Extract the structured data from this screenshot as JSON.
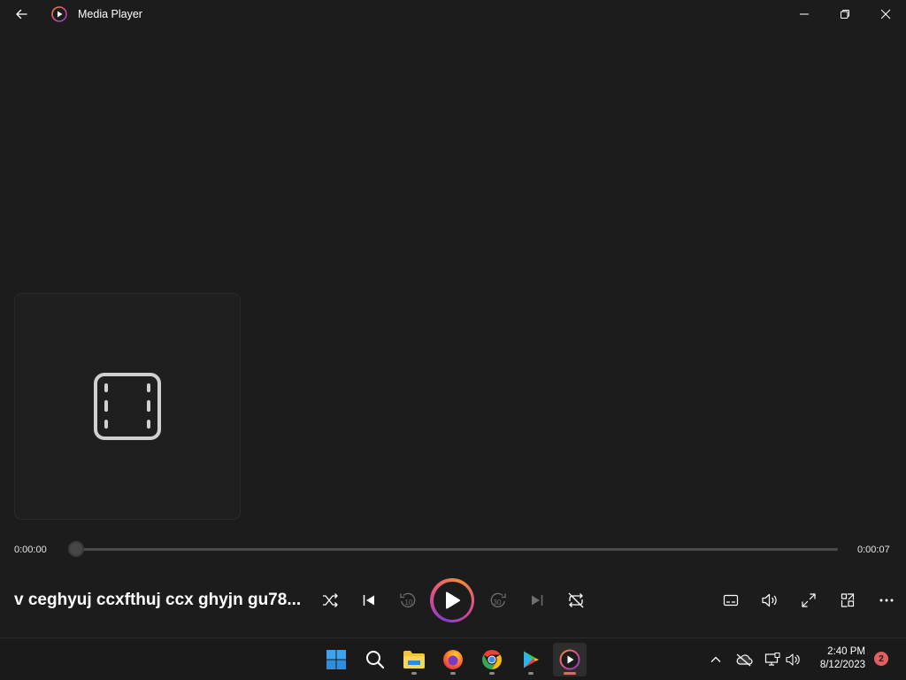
{
  "window": {
    "title": "Media Player"
  },
  "player": {
    "track_title": "v ceghyuj ccxfthuj ccx ghyjn gu78...",
    "time_current": "0:00:00",
    "time_total": "0:00:07",
    "progress": 0,
    "accent_colors": [
      "#8a3cc8",
      "#e0508a",
      "#f08a3c"
    ]
  },
  "controls": {
    "shuffle": "shuffle-icon",
    "previous": "previous-icon",
    "rewind": "10",
    "play": "play-icon",
    "forward": "30",
    "next": "next-icon",
    "repeat": "repeat-icon"
  },
  "taskbar": {
    "apps": [
      "start",
      "search",
      "file-explorer",
      "firefox",
      "chrome",
      "google-play",
      "media-player"
    ],
    "time": "2:40 PM",
    "date": "8/12/2023",
    "notifications": "2"
  }
}
